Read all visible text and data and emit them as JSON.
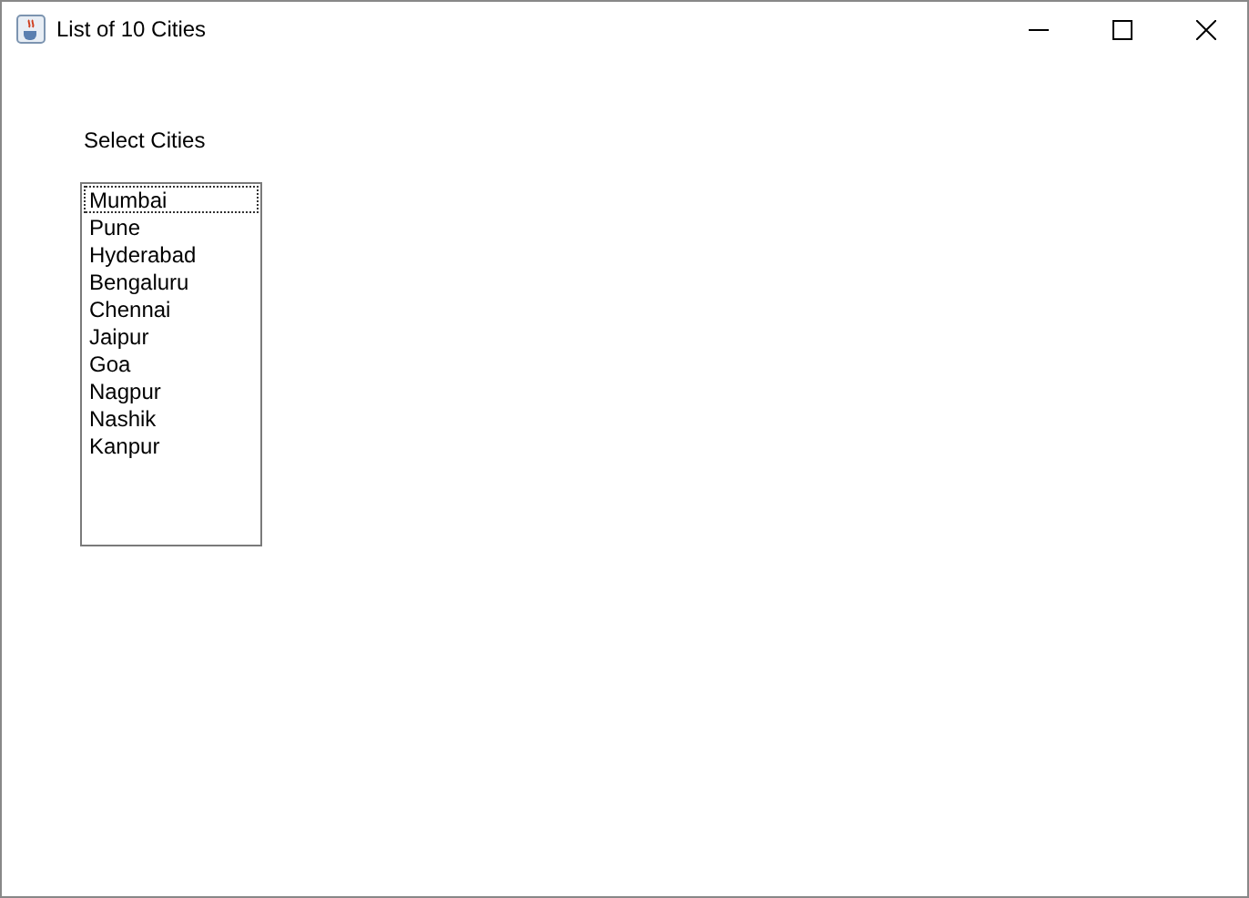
{
  "window": {
    "title": "List of 10 Cities"
  },
  "label": "Select Cities",
  "list": {
    "items": [
      {
        "text": "Mumbai",
        "selected": false,
        "focused": true
      },
      {
        "text": "Pune",
        "selected": false,
        "focused": false
      },
      {
        "text": "Hyderabad",
        "selected": false,
        "focused": false
      },
      {
        "text": "Bengaluru",
        "selected": false,
        "focused": false
      },
      {
        "text": "Chennai",
        "selected": false,
        "focused": false
      },
      {
        "text": "Jaipur",
        "selected": false,
        "focused": false
      },
      {
        "text": "Goa",
        "selected": false,
        "focused": false
      },
      {
        "text": "Nagpur",
        "selected": false,
        "focused": false
      },
      {
        "text": "Nashik",
        "selected": false,
        "focused": false
      },
      {
        "text": "Kanpur",
        "selected": false,
        "focused": false
      }
    ]
  }
}
